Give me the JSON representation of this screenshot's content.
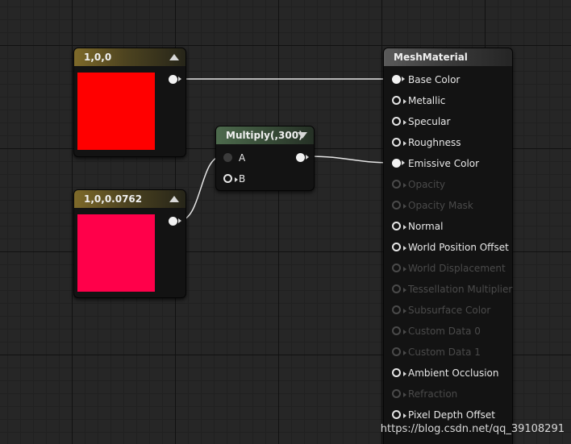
{
  "nodes": {
    "const1": {
      "title": "1,0,0",
      "color": "#ff0000"
    },
    "const2": {
      "title": "1,0,0.0762",
      "color": "#ff004a"
    },
    "multiply": {
      "title": "Multiply(,300)",
      "inputs": [
        "A",
        "B"
      ]
    },
    "material": {
      "title": "MeshMaterial",
      "inputs": [
        {
          "label": "Base Color",
          "state": "connected"
        },
        {
          "label": "Metallic",
          "state": "enabled"
        },
        {
          "label": "Specular",
          "state": "enabled"
        },
        {
          "label": "Roughness",
          "state": "enabled"
        },
        {
          "label": "Emissive Color",
          "state": "connected"
        },
        {
          "label": "Opacity",
          "state": "disabled"
        },
        {
          "label": "Opacity Mask",
          "state": "disabled"
        },
        {
          "label": "Normal",
          "state": "enabled"
        },
        {
          "label": "World Position Offset",
          "state": "enabled"
        },
        {
          "label": "World Displacement",
          "state": "disabled"
        },
        {
          "label": "Tessellation Multiplier",
          "state": "disabled"
        },
        {
          "label": "Subsurface Color",
          "state": "disabled"
        },
        {
          "label": "Custom Data 0",
          "state": "disabled"
        },
        {
          "label": "Custom Data 1",
          "state": "disabled"
        },
        {
          "label": "Ambient Occlusion",
          "state": "enabled"
        },
        {
          "label": "Refraction",
          "state": "disabled"
        },
        {
          "label": "Pixel Depth Offset",
          "state": "enabled"
        }
      ]
    }
  },
  "watermark": "https://blog.csdn.net/qq_39108291"
}
